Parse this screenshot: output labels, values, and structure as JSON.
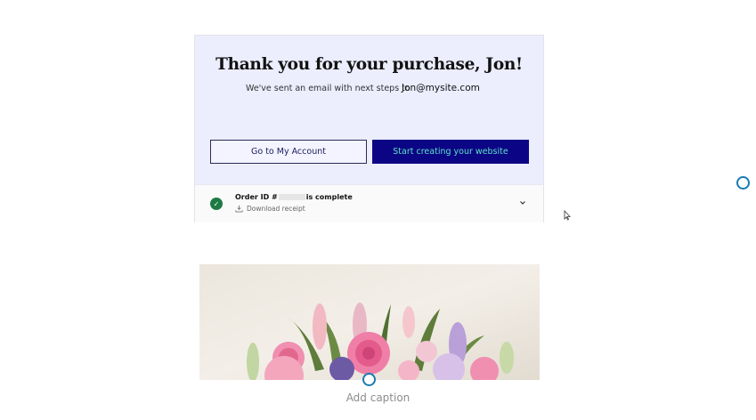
{
  "confirmation": {
    "title": "Thank you for your purchase, Jon!",
    "subtitle": "We've sent an email with next steps to",
    "email": "Jon@mysite.com"
  },
  "buttons": {
    "account_label": "Go to My Account",
    "create_label": "Start creating your website"
  },
  "order": {
    "prefix": "Order ID #",
    "suffix": "is complete",
    "receipt_label": "Download receipt"
  },
  "image_block": {
    "caption_placeholder": "Add caption",
    "image_icon": "flower-bouquet-photo"
  },
  "colors": {
    "hero_bg": "#ecedfd",
    "primary": "#0b0585",
    "primary_text": "#5de0c4",
    "success": "#1e7a44",
    "handle": "#1a7bb3"
  }
}
